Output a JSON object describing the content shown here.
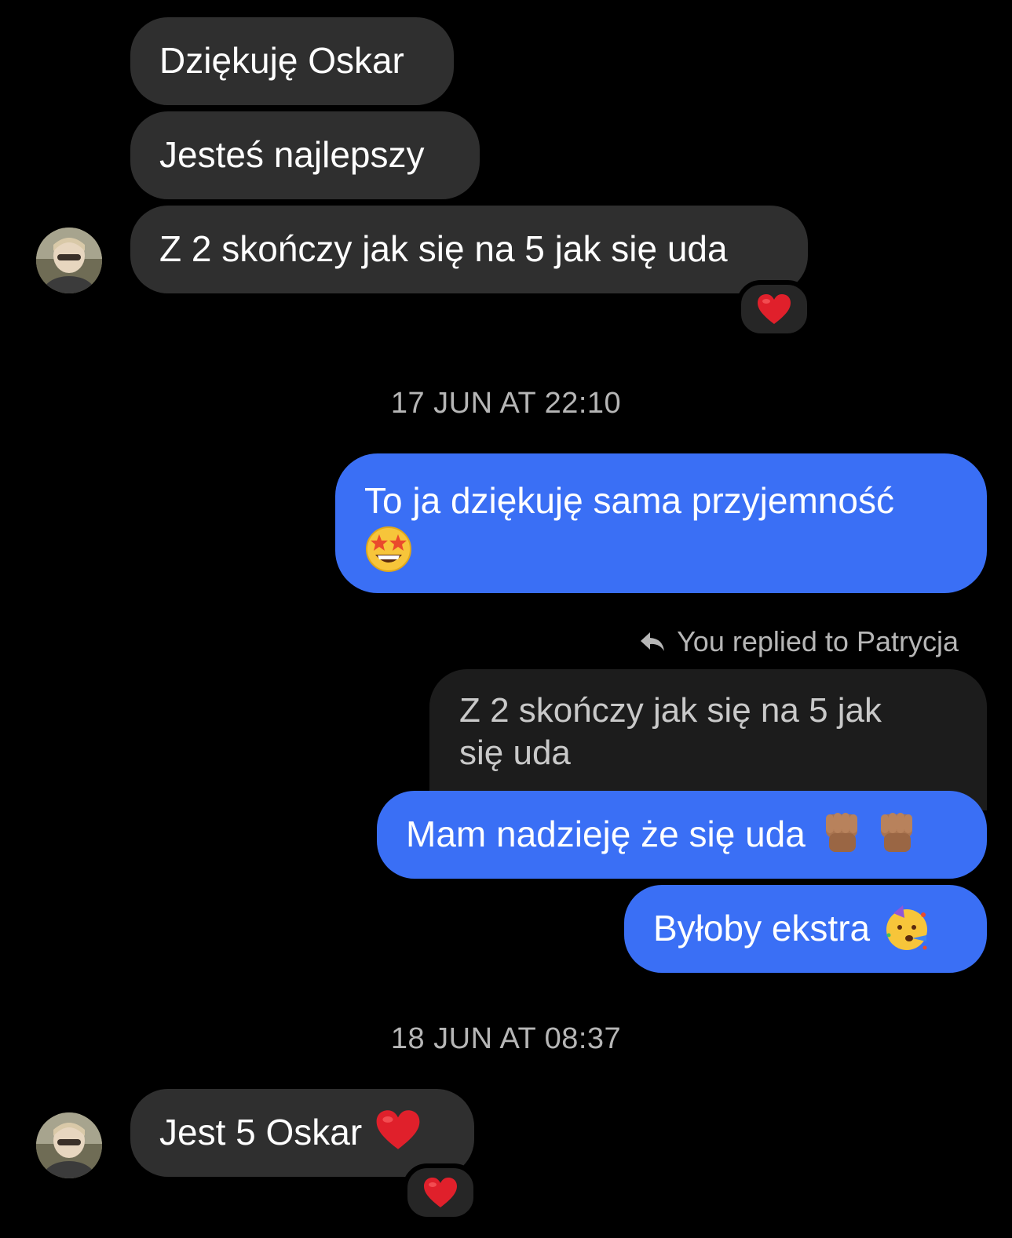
{
  "messages": {
    "m1": "Dziękuję Oskar",
    "m2": "Jesteś najlepszy",
    "m3": "Z 2 skończy jak się na 5 jak się uda",
    "m4": "To ja dziękuję sama przyjemność",
    "m5_quote": "Z 2 skończy jak się na 5 jak się uda",
    "m5": "Mam nadzieję że się uda",
    "m6": "Byłoby ekstra",
    "m7": "Jest 5 Oskar"
  },
  "timestamps": {
    "t1": "17 JUN AT 22:10",
    "t2": "18 JUN AT 08:37"
  },
  "reply": {
    "label": "You replied to Patrycja"
  },
  "colors": {
    "incoming_bubble": "#2f2f2f",
    "outgoing_bubble": "#3a6ff5",
    "quoted_bubble": "#1c1c1c",
    "reaction_heart": "#e0202b",
    "background": "#000000"
  },
  "icons": {
    "reaction": "heart-icon",
    "reply": "reply-arrow-icon",
    "emoji_star_struck": "star-struck-emoji",
    "emoji_fist": "raised-fist-emoji",
    "emoji_party": "partying-face-emoji",
    "emoji_heart": "red-heart-emoji"
  }
}
